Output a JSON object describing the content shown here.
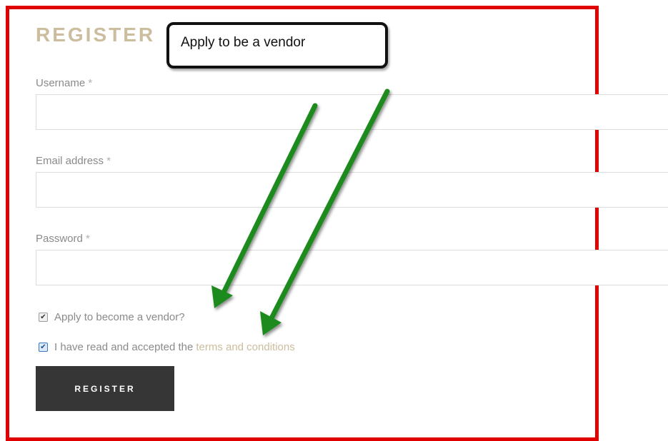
{
  "form": {
    "title": "REGISTER",
    "username_label": "Username",
    "email_label": "Email address",
    "password_label": "Password",
    "required_mark": "*",
    "username_value": "",
    "email_value": "",
    "password_value": "",
    "vendor_checkbox_label": "Apply to become a vendor?",
    "vendor_checked": true,
    "terms_prefix": "I have read and accepted the",
    "terms_link": "terms and conditions",
    "terms_checked": true,
    "submit_label": "REGISTER"
  },
  "annotation": {
    "callout_text": "Apply to be a vendor",
    "frame_color": "#e00000",
    "arrow_color": "#1a8a1a"
  }
}
